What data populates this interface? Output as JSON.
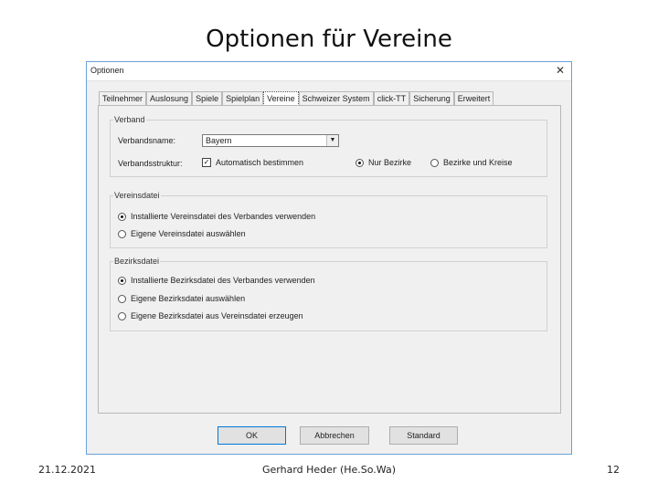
{
  "slide": {
    "title": "Optionen für Vereine",
    "footer_date": "21.12.2021",
    "footer_author": "Gerhard Heder (He.So.Wa)",
    "footer_page": "12"
  },
  "dialog": {
    "title": "Optionen",
    "close_icon": "close-icon",
    "tabs": [
      {
        "label": "Teilnehmer",
        "active": false
      },
      {
        "label": "Auslosung",
        "active": false
      },
      {
        "label": "Spiele",
        "active": false
      },
      {
        "label": "Spielplan",
        "active": false
      },
      {
        "label": "Vereine",
        "active": true
      },
      {
        "label": "Schweizer System",
        "active": false
      },
      {
        "label": "click-TT",
        "active": false
      },
      {
        "label": "Sicherung",
        "active": false
      },
      {
        "label": "Erweitert",
        "active": false
      }
    ],
    "verband": {
      "legend": "Verband",
      "name_label": "Verbandsname:",
      "name_value": "Bayern",
      "struktur_label": "Verbandsstruktur:",
      "auto_label": "Automatisch bestimmen",
      "auto_checked": true,
      "nur_bezirke": "Nur Bezirke",
      "bezirke_und_kreise": "Bezirke und Kreise"
    },
    "vereinsdatei": {
      "legend": "Vereinsdatei",
      "option1": "Installierte Vereinsdatei des Verbandes verwenden",
      "option2": "Eigene Vereinsdatei auswählen"
    },
    "bezirksdatei": {
      "legend": "Bezirksdatei",
      "option1": "Installierte Bezirksdatei des Verbandes verwenden",
      "option2": "Eigene Bezirksdatei auswählen",
      "option3": "Eigene Bezirksdatei aus Vereinsdatei erzeugen"
    },
    "buttons": {
      "ok": "OK",
      "cancel": "Abbrechen",
      "standard": "Standard"
    }
  }
}
